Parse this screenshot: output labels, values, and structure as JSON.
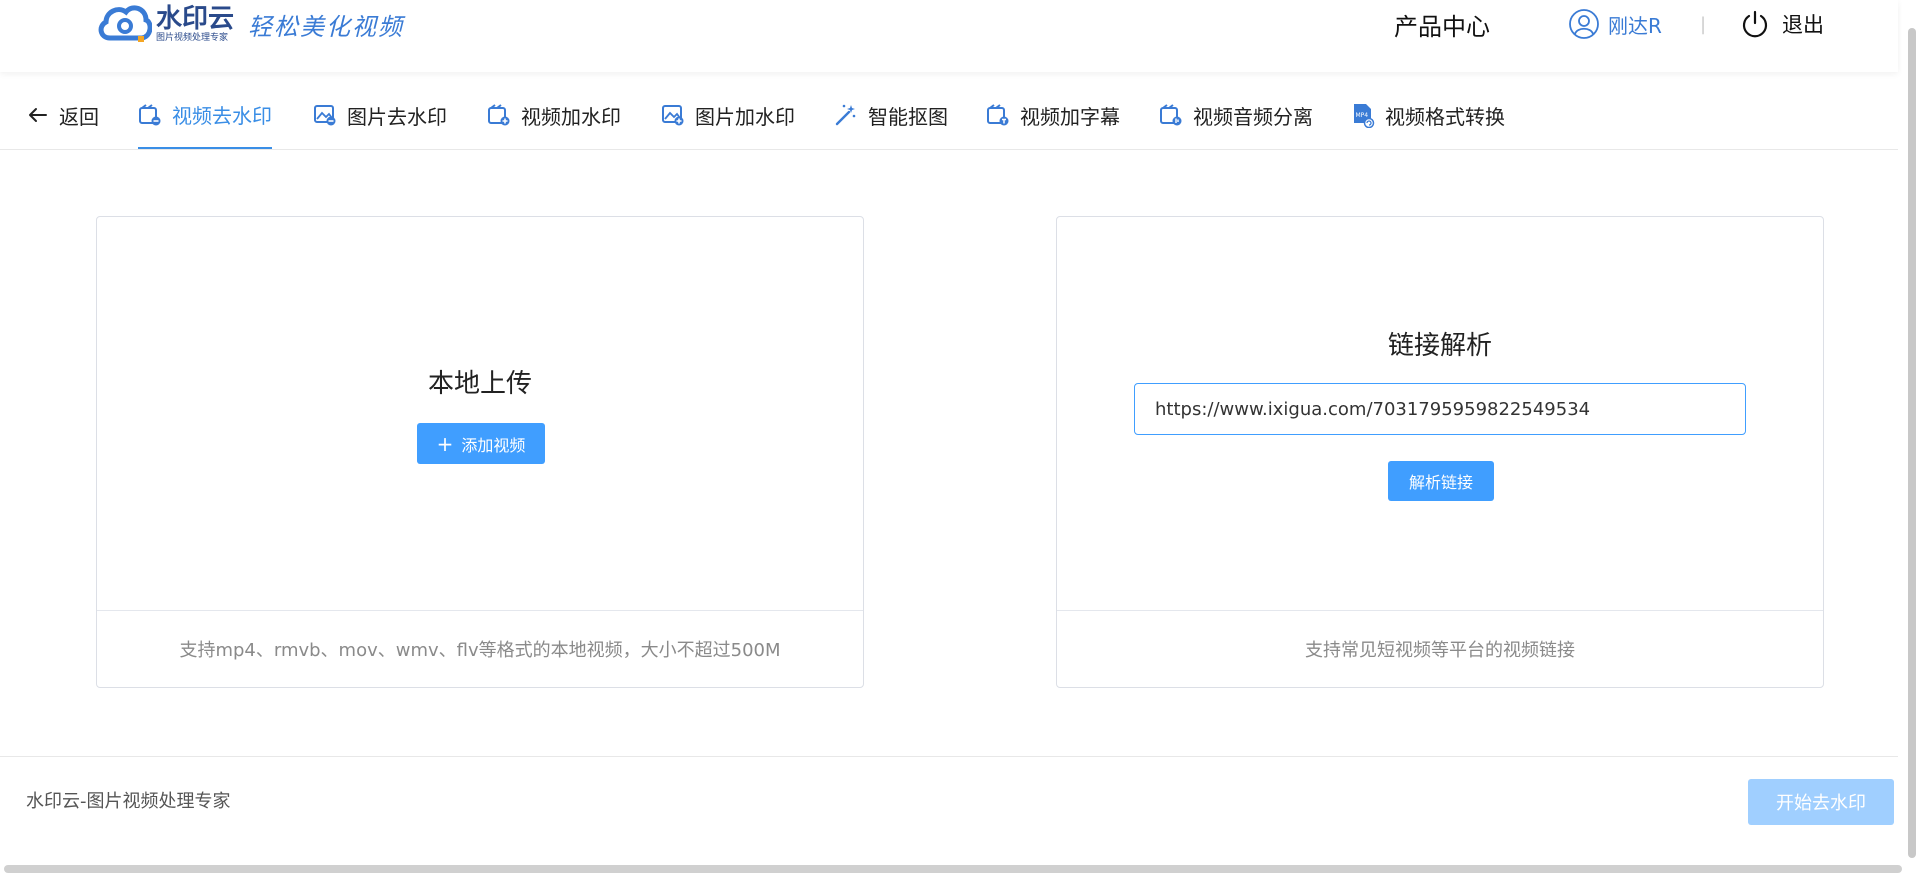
{
  "header": {
    "logo_name": "水印云",
    "logo_sub": "图片视频处理专家",
    "slogan": "轻松美化视频",
    "product_center": "产品中心",
    "username": "刚达R",
    "separator": "|",
    "logout": "退出",
    "brand_color": "#3a7bd5"
  },
  "nav": {
    "back": "返回",
    "tabs": [
      {
        "label": "视频去水印",
        "icon": "video-remove-watermark-icon",
        "active": true
      },
      {
        "label": "图片去水印",
        "icon": "image-remove-watermark-icon"
      },
      {
        "label": "视频加水印",
        "icon": "video-add-watermark-icon"
      },
      {
        "label": "图片加水印",
        "icon": "image-add-watermark-icon"
      },
      {
        "label": "智能抠图",
        "icon": "magic-wand-icon"
      },
      {
        "label": "视频加字幕",
        "icon": "video-subtitle-icon"
      },
      {
        "label": "视频音频分离",
        "icon": "video-audio-split-icon"
      },
      {
        "label": "视频格式转换",
        "icon": "mp4-convert-icon"
      }
    ],
    "active_color": "#3a8ee6"
  },
  "local_upload": {
    "title": "本地上传",
    "button": "添加视频",
    "hint": "支持mp4、rmvb、mov、wmv、flv等格式的本地视频，大小不超过500M"
  },
  "link_parse": {
    "title": "链接解析",
    "url_value": "https://www.ixigua.com/7031795959822549534",
    "button": "解析链接",
    "hint": "支持常见短视频等平台的视频链接"
  },
  "footer": {
    "text": "水印云-图片视频处理专家",
    "start_button": "开始去水印"
  }
}
